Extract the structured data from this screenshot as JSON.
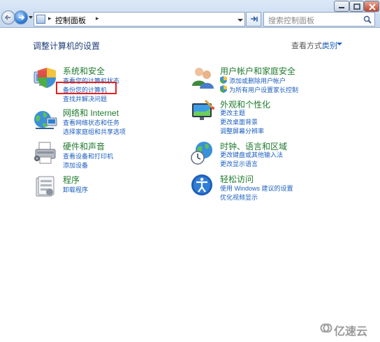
{
  "address_bar": {
    "path": "控制面板",
    "search_placeholder": "搜索控制面板"
  },
  "header": {
    "title": "调整计算机的设置",
    "view_by_label": "查看方式:",
    "view_by_value": "类别"
  },
  "categories": [
    {
      "title": "系统和安全",
      "icon": "shield-pc-icon",
      "links": [
        "查看您的计算机状态",
        "备份您的计算机",
        "查找并解决问题"
      ]
    },
    {
      "title": "网络和 Internet",
      "icon": "network-globe-icon",
      "links": [
        "查看网络状态和任务",
        "选择家庭组和共享选项"
      ]
    },
    {
      "title": "硬件和声音",
      "icon": "printer-icon",
      "links": [
        "查看设备和打印机",
        "添加设备"
      ]
    },
    {
      "title": "程序",
      "icon": "programs-icon",
      "links": [
        "卸载程序"
      ]
    },
    {
      "title": "用户帐户和家庭安全",
      "icon": "users-icon",
      "links": [
        "添加或删除用户帐户",
        "为所有用户设置家长控制"
      ]
    },
    {
      "title": "外观和个性化",
      "icon": "appearance-icon",
      "links": [
        "更改主题",
        "更改桌面背景",
        "调整屏幕分辨率"
      ]
    },
    {
      "title": "时钟、语言和区域",
      "icon": "clock-globe-icon",
      "links": [
        "更改键盘或其他输入法",
        "更改显示语言"
      ]
    },
    {
      "title": "轻松访问",
      "icon": "ease-of-access-icon",
      "links": [
        "使用 Windows 建议的设置",
        "优化视频显示"
      ]
    }
  ],
  "watermark": {
    "text": "亿速云"
  },
  "colors": {
    "category_title": "#1f7a2e",
    "link": "#1d5fbf",
    "highlight": "#e32020"
  }
}
